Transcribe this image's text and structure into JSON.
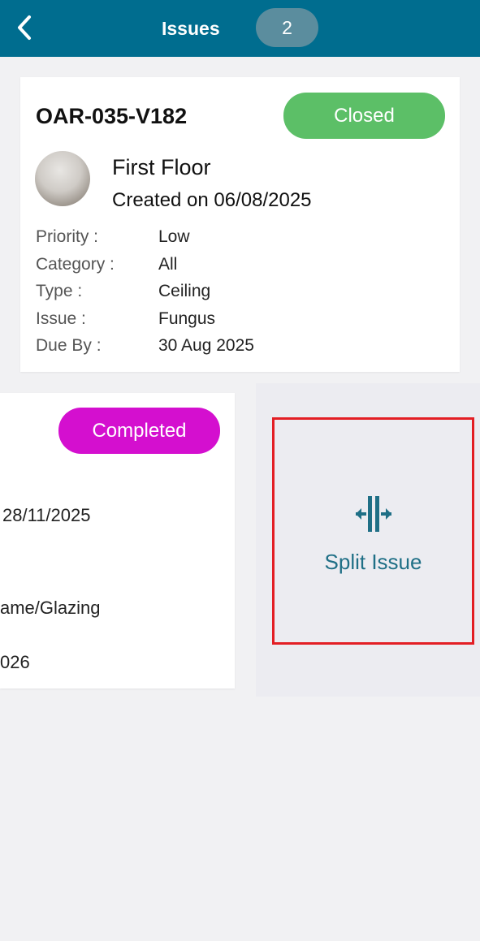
{
  "header": {
    "title": "Issues",
    "count": "2",
    "back_icon": "chevron-left-icon"
  },
  "primary_issue": {
    "id": "OAR-035-V182",
    "status": "Closed",
    "status_color": "#5cbf67",
    "location": "First Floor",
    "created": "Created on 06/08/2025",
    "details": [
      {
        "label": "Priority :",
        "value": "Low"
      },
      {
        "label": "Category :",
        "value": "All"
      },
      {
        "label": "Type :",
        "value": "Ceiling"
      },
      {
        "label": "Issue :",
        "value": "Fungus"
      },
      {
        "label": "Due By :",
        "value": "30 Aug 2025"
      }
    ]
  },
  "secondary_issue": {
    "status": "Completed",
    "status_color": "#d40fcf",
    "visible_fragments": [
      "28/11/2025",
      "ame/Glazing",
      "026"
    ]
  },
  "split_action": {
    "label": "Split Issue",
    "icon": "split-icon",
    "color": "#1f6f86"
  },
  "colors": {
    "header": "#006d8f",
    "highlight_border": "#e31e24"
  }
}
